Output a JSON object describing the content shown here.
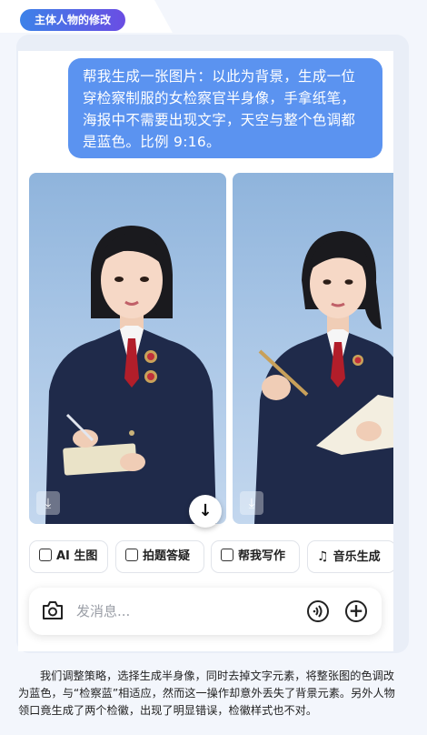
{
  "section_tag": "主体人物的修改",
  "chat": {
    "prompt_line1": "帮我生成一张图片：以此为背景，生成一位",
    "prompt_line2": "穿检察制服的女检察官半身像，手拿纸笔，",
    "prompt_line3": "海报中不需要出现文字，天空与整个色调都",
    "prompt_line4": "是蓝色。比例 9:16。"
  },
  "images": [
    {
      "icon": "download-icon"
    },
    {
      "icon": "download-icon"
    }
  ],
  "scroll_down_icon": "arrow-down-icon",
  "chips": [
    {
      "label": "AI 生图",
      "icon": "image-icon"
    },
    {
      "label": "拍题答疑",
      "icon": "scan-question-icon"
    },
    {
      "label": "帮我写作",
      "icon": "edit-icon"
    },
    {
      "label": "音乐生成",
      "icon": "music-icon"
    }
  ],
  "composer": {
    "placeholder": "发消息..."
  },
  "caption": "我们调整策略，选择生成半身像，同时去掉文字元素，将整张图的色调改为蓝色，与“检察蓝”相适应，然而这一操作却意外丢失了背景元素。另外人物领口竟生成了两个检徽，出现了明显错误，检徽样式也不对。",
  "colors": {
    "bubble": "#5b93f0",
    "tag_gradient_start": "#3c82e8",
    "tag_gradient_end": "#6a4de3",
    "uniform": "#1f2a4a",
    "tie": "#b21e2a"
  }
}
